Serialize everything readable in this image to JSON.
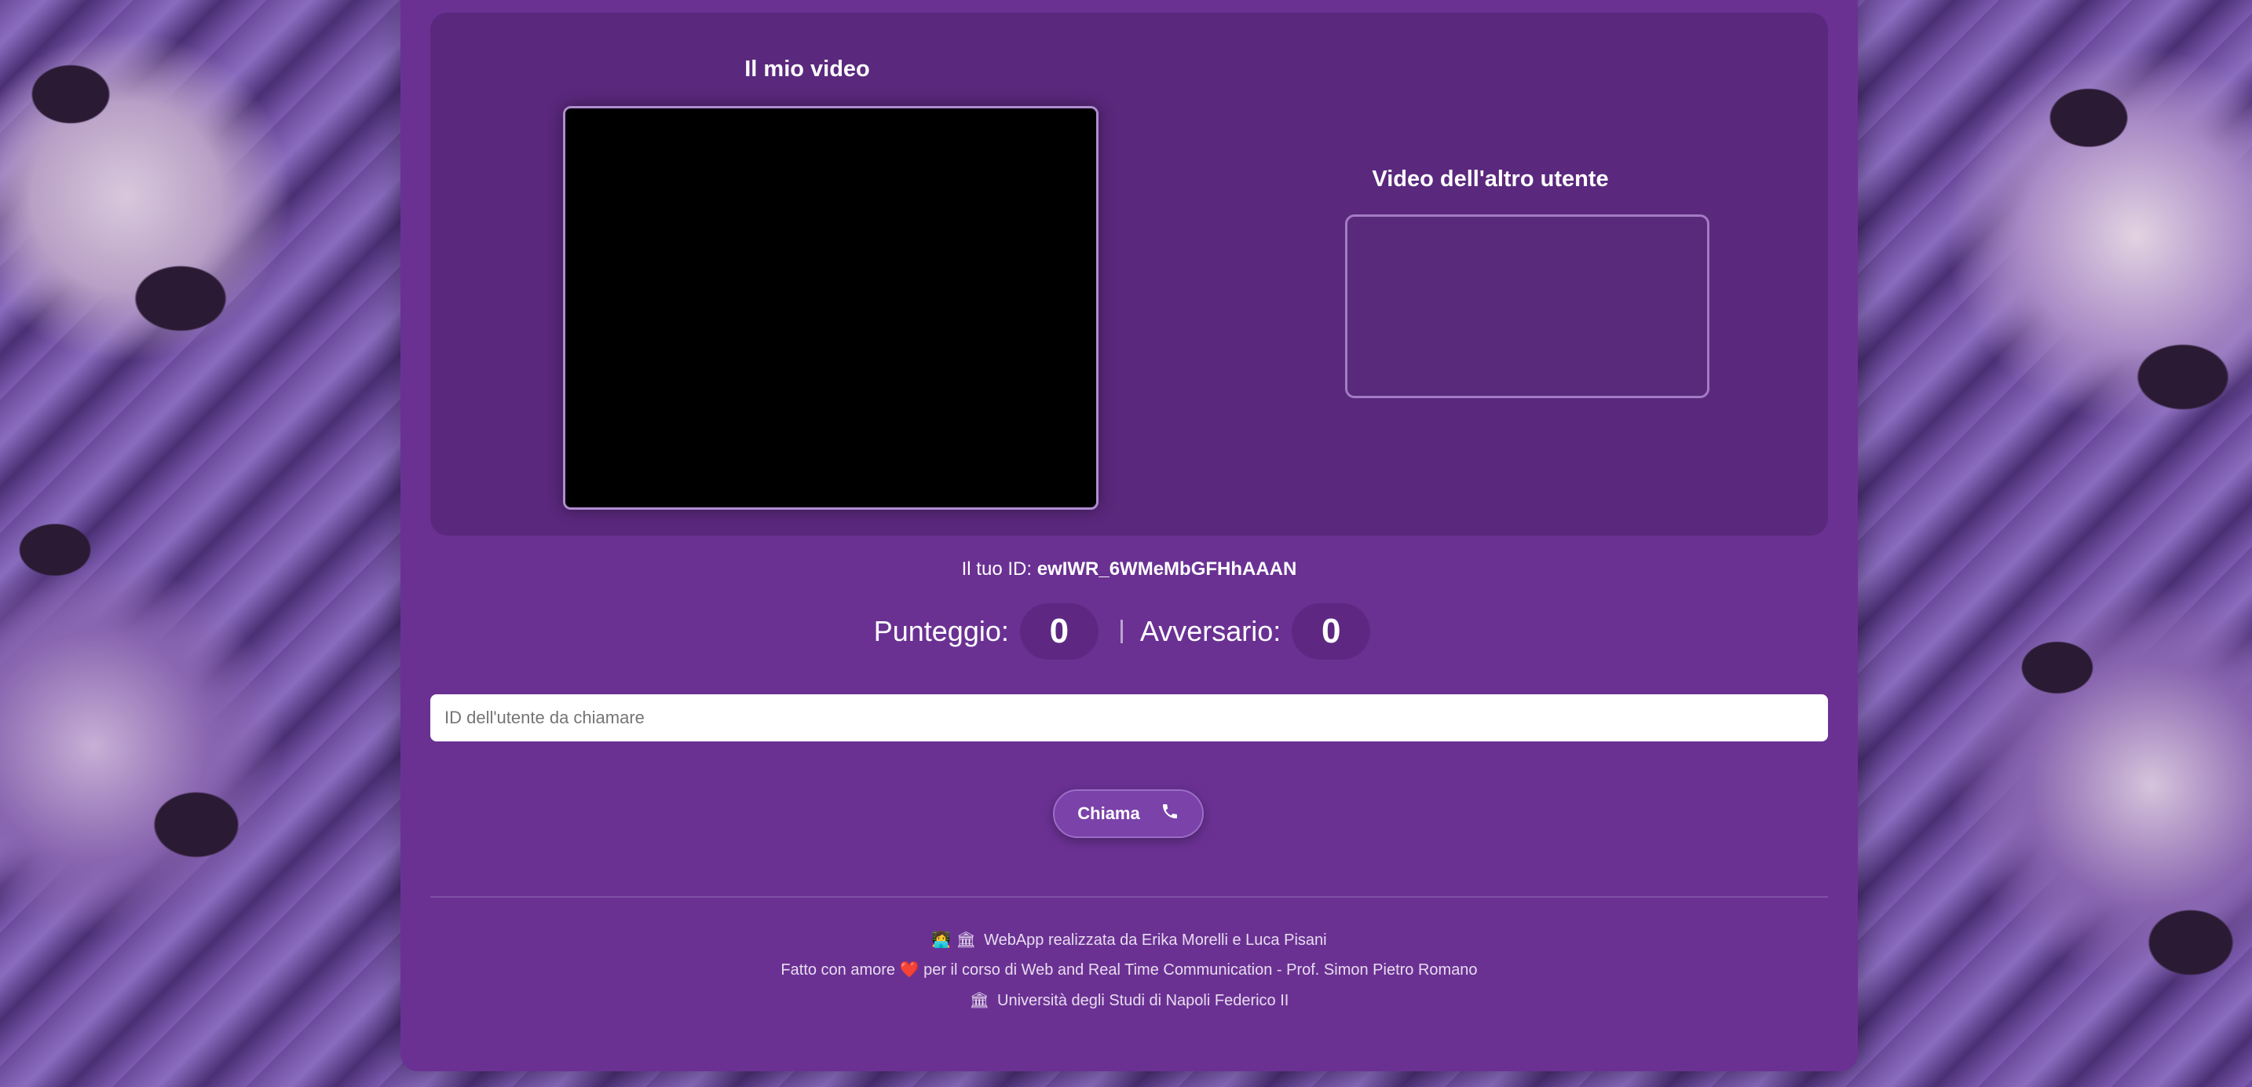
{
  "videos": {
    "my_video_title": "Il mio video",
    "other_video_title": "Video dell'altro utente"
  },
  "identity": {
    "label": "Il tuo ID:",
    "value": "ewIWR_6WMeMbGFHhAAAN"
  },
  "score": {
    "player_label": "Punteggio:",
    "player_value": "0",
    "opponent_label": "Avversario:",
    "opponent_value": "0"
  },
  "call": {
    "input_placeholder": "ID dell'utente da chiamare",
    "input_value": "",
    "button_label": "Chiama",
    "button_icon": "phone-icon"
  },
  "footer": {
    "line1_icons": "👩‍💻 🏛",
    "line1_text": "WebApp realizzata da Erika Morelli e Luca Pisani",
    "line2_before": "Fatto con amore",
    "line2_heart": "❤️",
    "line2_after": "per il corso di Web and Real Time Communication - Prof. Simon Pietro Romano",
    "line3_icon": "🏛",
    "line3_text": "Università degli Studi di Napoli Federico II"
  },
  "colors": {
    "panel": "#6a3193",
    "button": "#7b42aa",
    "text": "#ffffff"
  }
}
